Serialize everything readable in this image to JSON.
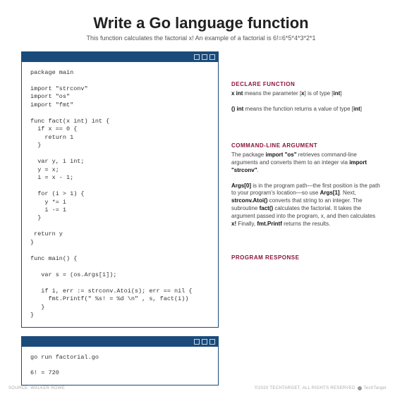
{
  "title": "Write a Go language function",
  "subtitle": "This function calculates the factorial x! An example of a factorial is 6!=6*5*4*3*2*1",
  "code_main": "package main\n\nimport \"strconv\"\nimport \"os\"\nimport \"fmt\"\n\nfunc fact(x int) int {\n  if x == 0 {\n    return 1\n  }\n\n  var y, i int;\n  y = x;\n  i = x - 1;\n\n  for (i > 1) {\n    y *= i\n    i -= 1\n  }\n\n return y\n}\n\nfunc main() {\n\n   var s = (os.Args[1]);\n\n   if i, err := strconv.Atoi(s); err == nil {\n     fmt.Printf(\" %s! = %d \\n\" , s, fact(i))\n   }\n}",
  "code_output": "go run factorial.go\n\n6! = 720",
  "notes": {
    "declare": {
      "head": "DECLARE FUNCTION",
      "line1_pre": "x int",
      "line1_mid1": " means the parameter [",
      "line1_mid2": "x",
      "line1_mid3": "] is of type [",
      "line1_mid4": "int",
      "line1_end": "]",
      "line2_pre": "() int",
      "line2_mid1": "  means the function returns a value of type [",
      "line2_mid2": "int",
      "line2_end": "]"
    },
    "cmdline": {
      "head": "COMMAND-LINE ARGUMENT",
      "p1a": "The package ",
      "p1b": "import \"os\"",
      "p1c": " retrieves command-line arguments and converts them to an integer via ",
      "p1d": "import \"strconv\"",
      "p1e": ".",
      "p2a": "Args[0]",
      "p2b": " is in the program path—the first position is the path to your program's location—so use ",
      "p2c": "Args[1]",
      "p2d": ". Next, ",
      "p2e": "strconv.Atoi()",
      "p2f": " converts that string to an integer. The subroutine ",
      "p2g": "fact()",
      "p2h": " calculates the factorial. It takes the argument passed into the program, x, and then calculates ",
      "p2i": "x!",
      "p2j": " Finally, ",
      "p2k": "fmt.Printf",
      "p2l": " returns the results."
    },
    "response": {
      "head": "PROGRAM RESPONSE"
    }
  },
  "footer": {
    "left": "SOURCE: WALKER ROWE",
    "right": "©2020 TECHTARGET. ALL RIGHTS RESERVED",
    "brand": "TechTarget"
  }
}
